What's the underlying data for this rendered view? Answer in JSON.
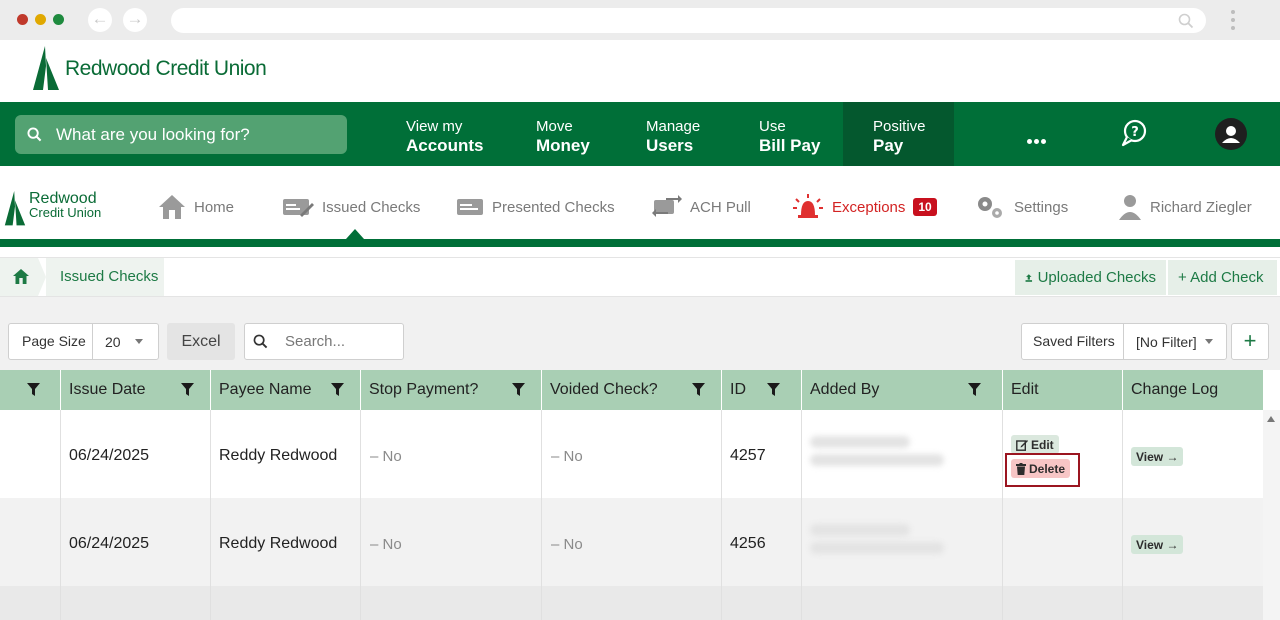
{
  "brand": {
    "name": "Redwood Credit Union"
  },
  "search": {
    "placeholder": "What are you looking for?"
  },
  "topnav": {
    "items": [
      {
        "line1": "View my",
        "line2": "Accounts"
      },
      {
        "line1": "Move",
        "line2": "Money"
      },
      {
        "line1": "Manage",
        "line2": "Users"
      },
      {
        "line1": "Use",
        "line2": "Bill Pay"
      },
      {
        "line1": "Positive",
        "line2": "Pay"
      }
    ]
  },
  "appnav": {
    "logo_line1": "Redwood",
    "logo_line2": "Credit Union",
    "tabs": [
      {
        "label": "Home"
      },
      {
        "label": "Issued Checks"
      },
      {
        "label": "Presented Checks"
      },
      {
        "label": "ACH Pull"
      },
      {
        "label": "Exceptions",
        "badge": "10"
      },
      {
        "label": "Settings"
      },
      {
        "label": "Richard Ziegler"
      }
    ]
  },
  "breadcrumb": {
    "current": "Issued Checks"
  },
  "actions": {
    "uploaded": "Uploaded Checks",
    "add": "+ Add Check"
  },
  "toolbar": {
    "page_size_label": "Page Size",
    "page_size_value": "20",
    "excel_label": "Excel",
    "search_placeholder": "Search...",
    "saved_filters_label": "Saved Filters",
    "filter_value": "[No Filter]",
    "add_label": "+"
  },
  "table": {
    "columns": [
      "Issue Date",
      "Payee Name",
      "Stop Payment?",
      "Voided Check?",
      "ID",
      "Added By",
      "Edit",
      "Change Log"
    ],
    "rows": [
      {
        "issue_date": "06/24/2025",
        "payee": "Reddy Redwood",
        "stop_payment": "– No",
        "voided": "– No",
        "id": "4257",
        "edit": "Edit",
        "delete": "Delete",
        "log": "View →"
      },
      {
        "issue_date": "06/24/2025",
        "payee": "Reddy Redwood",
        "stop_payment": "– No",
        "voided": "– No",
        "id": "4256",
        "log": "View →"
      }
    ]
  },
  "colors": {
    "brand_green": "#006f38",
    "header_green": "#a9cfb4",
    "danger": "#c8101e"
  }
}
